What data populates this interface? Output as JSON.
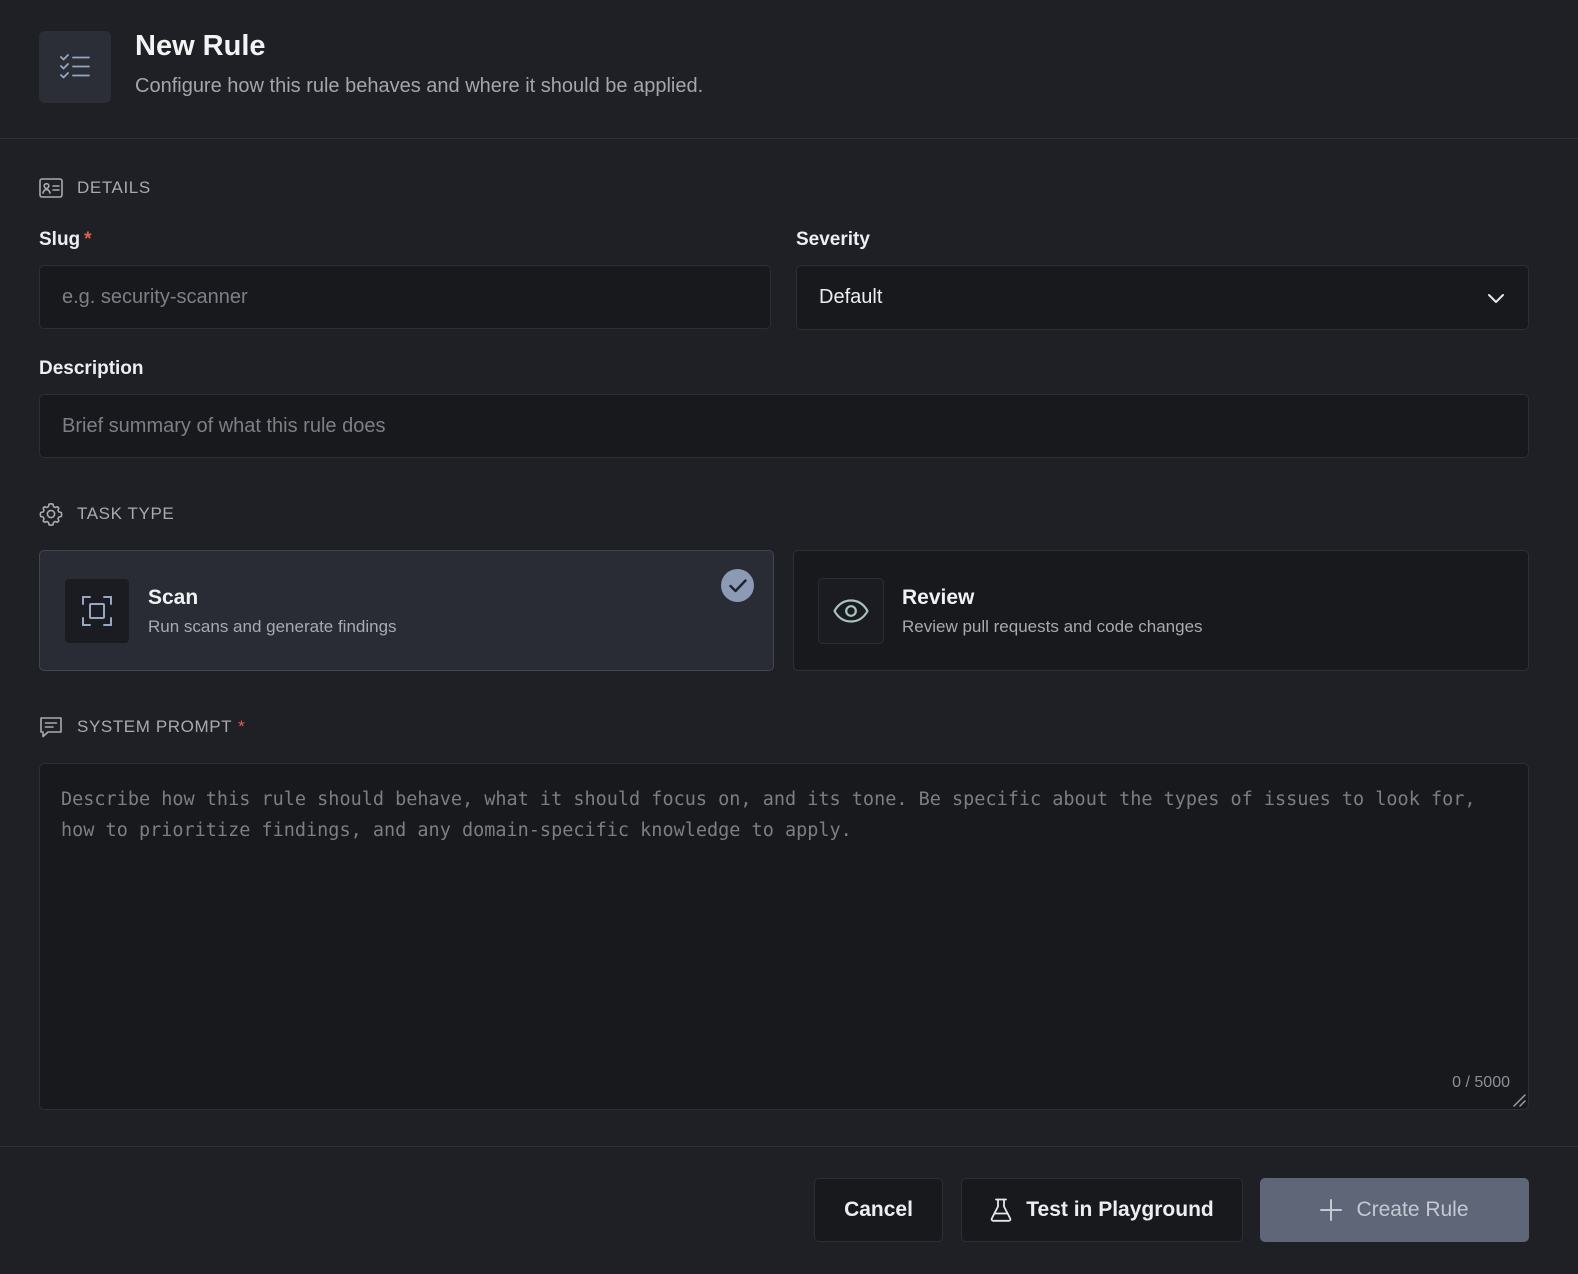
{
  "header": {
    "icon": "checklist-icon",
    "title": "New Rule",
    "subtitle": "Configure how this rule behaves and where it should be applied."
  },
  "details": {
    "section_label": "DETAILS",
    "section_icon": "id-card-icon",
    "slug": {
      "label": "Slug",
      "required_mark": "*",
      "value": "",
      "placeholder": "e.g. security-scanner"
    },
    "severity": {
      "label": "Severity",
      "value": "Default"
    },
    "description": {
      "label": "Description",
      "value": "",
      "placeholder": "Brief summary of what this rule does"
    }
  },
  "task_type": {
    "section_label": "TASK TYPE",
    "section_icon": "gear-icon",
    "options": [
      {
        "title": "Scan",
        "desc": "Run scans and generate findings",
        "icon": "scan-frame-icon",
        "selected": true
      },
      {
        "title": "Review",
        "desc": "Review pull requests and code changes",
        "icon": "eye-icon",
        "selected": false
      }
    ]
  },
  "system_prompt": {
    "section_label": "SYSTEM PROMPT",
    "required_mark": "*",
    "section_icon": "message-icon",
    "value": "",
    "placeholder": "Describe how this rule should behave, what it should focus on, and its tone. Be specific about the types of issues to look for, how to prioritize findings, and any domain-specific knowledge to apply.",
    "counter": "0 / 5000"
  },
  "footer": {
    "cancel_label": "Cancel",
    "playground_label": "Test in Playground",
    "playground_icon": "flask-icon",
    "create_label": "Create Rule",
    "create_icon": "plus-icon"
  },
  "colors": {
    "background": "#1f2025",
    "input_bg": "#18191d",
    "selected_card_bg": "#292c35",
    "accent": "#8d9ab5",
    "primary_button": "#5e6677",
    "required": "#e0614f"
  }
}
